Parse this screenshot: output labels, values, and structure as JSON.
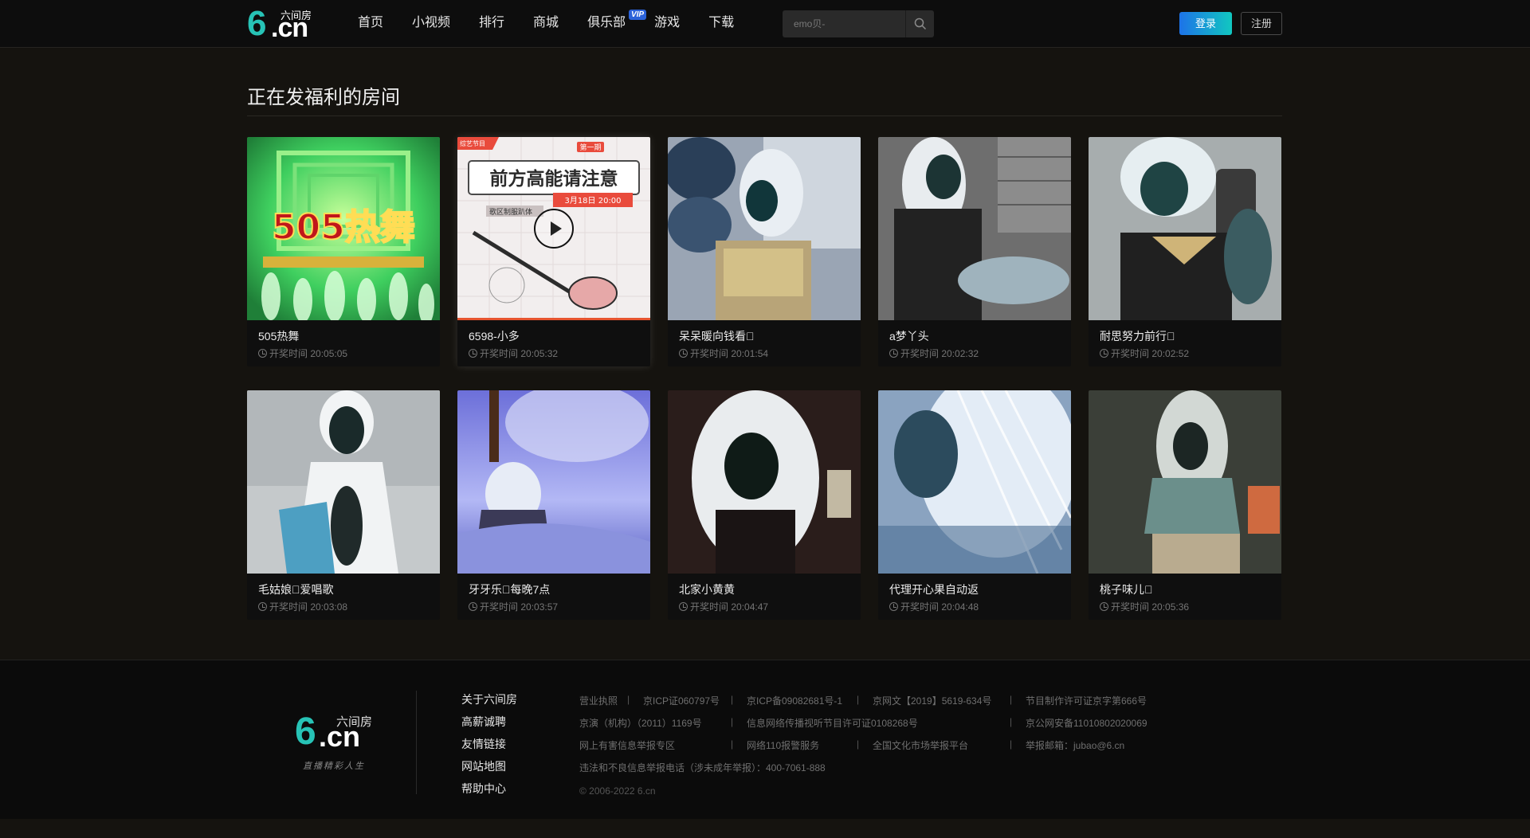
{
  "header": {
    "logo": {
      "mark": "6",
      "domain": ".cn",
      "brand": "六间房"
    },
    "nav": [
      {
        "label": "首页"
      },
      {
        "label": "小视频"
      },
      {
        "label": "排行"
      },
      {
        "label": "商城"
      },
      {
        "label": "俱乐部",
        "badge": "VIP"
      },
      {
        "label": "游戏"
      },
      {
        "label": "下载"
      }
    ],
    "search": {
      "placeholder": "emo贝-",
      "icon": "search-icon"
    },
    "login_label": "登录",
    "register_label": "注册",
    "accent_gradient": [
      "#1d73e8",
      "#11c7c0"
    ]
  },
  "section": {
    "title": "正在发福利的房间",
    "rooms": [
      {
        "title": "505热舞",
        "time_prefix": "开奖时间",
        "time": "20:05:05",
        "thumb_text": "505热舞"
      },
      {
        "title": "6598-小多",
        "time_prefix": "开奖时间",
        "time": "20:05:32",
        "thumb_text": "前方高能请注意",
        "thumb_sub": "3月18日 20:00",
        "thumb_tag": "第一期",
        "thumb_corner": "综艺节目",
        "thumb_sub2": "歌区制服趴体"
      },
      {
        "title": "呆呆暖向钱看\u0000",
        "time_prefix": "开奖时间",
        "time": "20:01:54"
      },
      {
        "title": "a梦丫头",
        "time_prefix": "开奖时间",
        "time": "20:02:32"
      },
      {
        "title": "耐思努力前行\u0000",
        "time_prefix": "开奖时间",
        "time": "20:02:52"
      },
      {
        "title": "毛姑娘\u0000爱唱歌",
        "time_prefix": "开奖时间",
        "time": "20:03:08"
      },
      {
        "title": "牙牙乐\u0000每晚7点",
        "time_prefix": "开奖时间",
        "time": "20:03:57"
      },
      {
        "title": "北家小黄黄",
        "time_prefix": "开奖时间",
        "time": "20:04:47"
      },
      {
        "title": "代理开心果自动返",
        "time_prefix": "开奖时间",
        "time": "20:04:48"
      },
      {
        "title": "桃子味儿\u0000",
        "time_prefix": "开奖时间",
        "time": "20:05:36"
      }
    ]
  },
  "footer": {
    "logo": {
      "mark": "6",
      "domain": ".cn",
      "brand": "六间房",
      "slogan": "直播精彩人生"
    },
    "links": [
      "关于六间房",
      "高薪诚聘",
      "友情链接",
      "网站地图",
      "帮助中心"
    ],
    "legal": {
      "row1": [
        "营业执照",
        "京ICP证060797号",
        "京ICP备09082681号-1",
        "京网文【2019】5619-634号",
        "节目制作许可证京字第666号"
      ],
      "row2": [
        "京演（机构）（2011）1169号",
        "信息网络传播视听节目许可证0108268号",
        "京公网安备11010802020069"
      ],
      "row3": [
        "网上有害信息举报专区",
        "网络110报警服务",
        "全国文化市场举报平台",
        "举报邮箱：jubao@6.cn"
      ],
      "row4": "违法和不良信息举报电话（涉未成年举报）：400-7061-888",
      "copyright": "© 2006-2022 6.cn"
    }
  }
}
